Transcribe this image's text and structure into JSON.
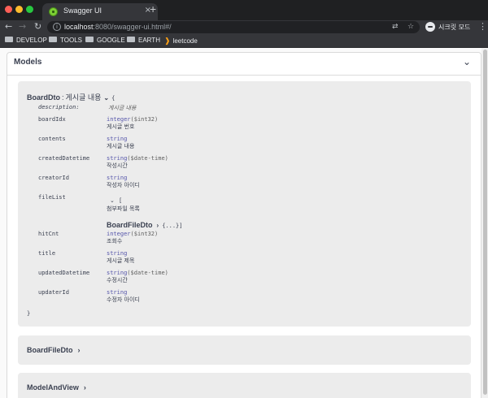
{
  "browser": {
    "tab_title": "Swagger UI",
    "tab_close": "×",
    "new_tab": "+",
    "url_host": "localhost",
    "url_path": ":8080/swagger-ui.html#/",
    "incognito_label": "시크릿 모드",
    "bookmarks": [
      {
        "label": "DEVELOP",
        "icon": "folder-icon"
      },
      {
        "label": "TOOLS",
        "icon": "folder-icon"
      },
      {
        "label": "GOOGLE",
        "icon": "folder-icon"
      },
      {
        "label": "EARTH",
        "icon": "folder-icon"
      },
      {
        "label": "leetcode",
        "icon": "leetcode-icon"
      }
    ]
  },
  "models": {
    "title": "Models",
    "expanded_model": {
      "name": "BoardDto",
      "separator": ":",
      "title_desc": "게시글 내용",
      "open_brace": "{",
      "description_label": "description:",
      "description_value": "게시글 내용",
      "properties": [
        {
          "name": "boardIdx",
          "type": "integer",
          "format": "($int32)",
          "desc": "게시글 번호"
        },
        {
          "name": "contents",
          "type": "string",
          "format": "",
          "desc": "게시글 내용"
        },
        {
          "name": "createdDatetime",
          "type": "string",
          "format": "($date-time)",
          "desc": "작성시간"
        },
        {
          "name": "creatorId",
          "type": "string",
          "format": "",
          "desc": "작성자 아이디"
        },
        {
          "name": "fileList",
          "type": "",
          "format": "",
          "desc": "첨부파일 목록"
        },
        {
          "name": "hitCnt",
          "type": "integer",
          "format": "($int32)",
          "desc": "조회수"
        },
        {
          "name": "title",
          "type": "string",
          "format": "",
          "desc": "게시글 제목"
        },
        {
          "name": "updatedDatetime",
          "type": "string",
          "format": "($date-time)",
          "desc": "수정시간"
        },
        {
          "name": "updaterId",
          "type": "string",
          "format": "",
          "desc": "수정자 아이디"
        }
      ],
      "array_bracket": "[",
      "nested_name": "BoardFileDto",
      "nested_collapsed": "{...}]",
      "close_brace": "}"
    },
    "collapsed_models": [
      "BoardFileDto",
      "ModelAndView"
    ]
  },
  "colors": {
    "chrome_dark": "#35363a",
    "model_bg": "#ececec",
    "type_color": "#5555aa",
    "text": "#3b4151"
  }
}
